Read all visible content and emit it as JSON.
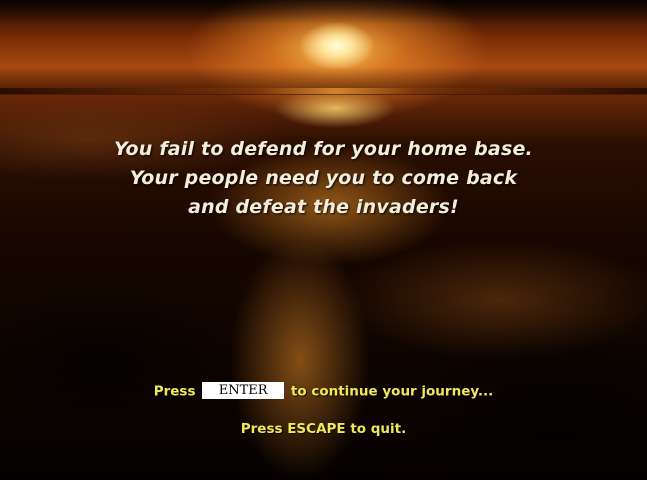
{
  "message": {
    "line1": "You fail to defend for your home base.",
    "line2": "Your people need you to come back",
    "line3": "and defeat the invaders!"
  },
  "prompts": {
    "continue_prefix": "Press",
    "enter_key": "ENTER",
    "continue_suffix": "to continue your journey...",
    "quit": "Press ESCAPE to quit."
  },
  "colors": {
    "message_text": "#f4eddc",
    "prompt_text": "#f0e85a",
    "key_background": "#ffffff",
    "key_text": "#000000"
  },
  "background": {
    "scene": "sunset-over-sea"
  }
}
